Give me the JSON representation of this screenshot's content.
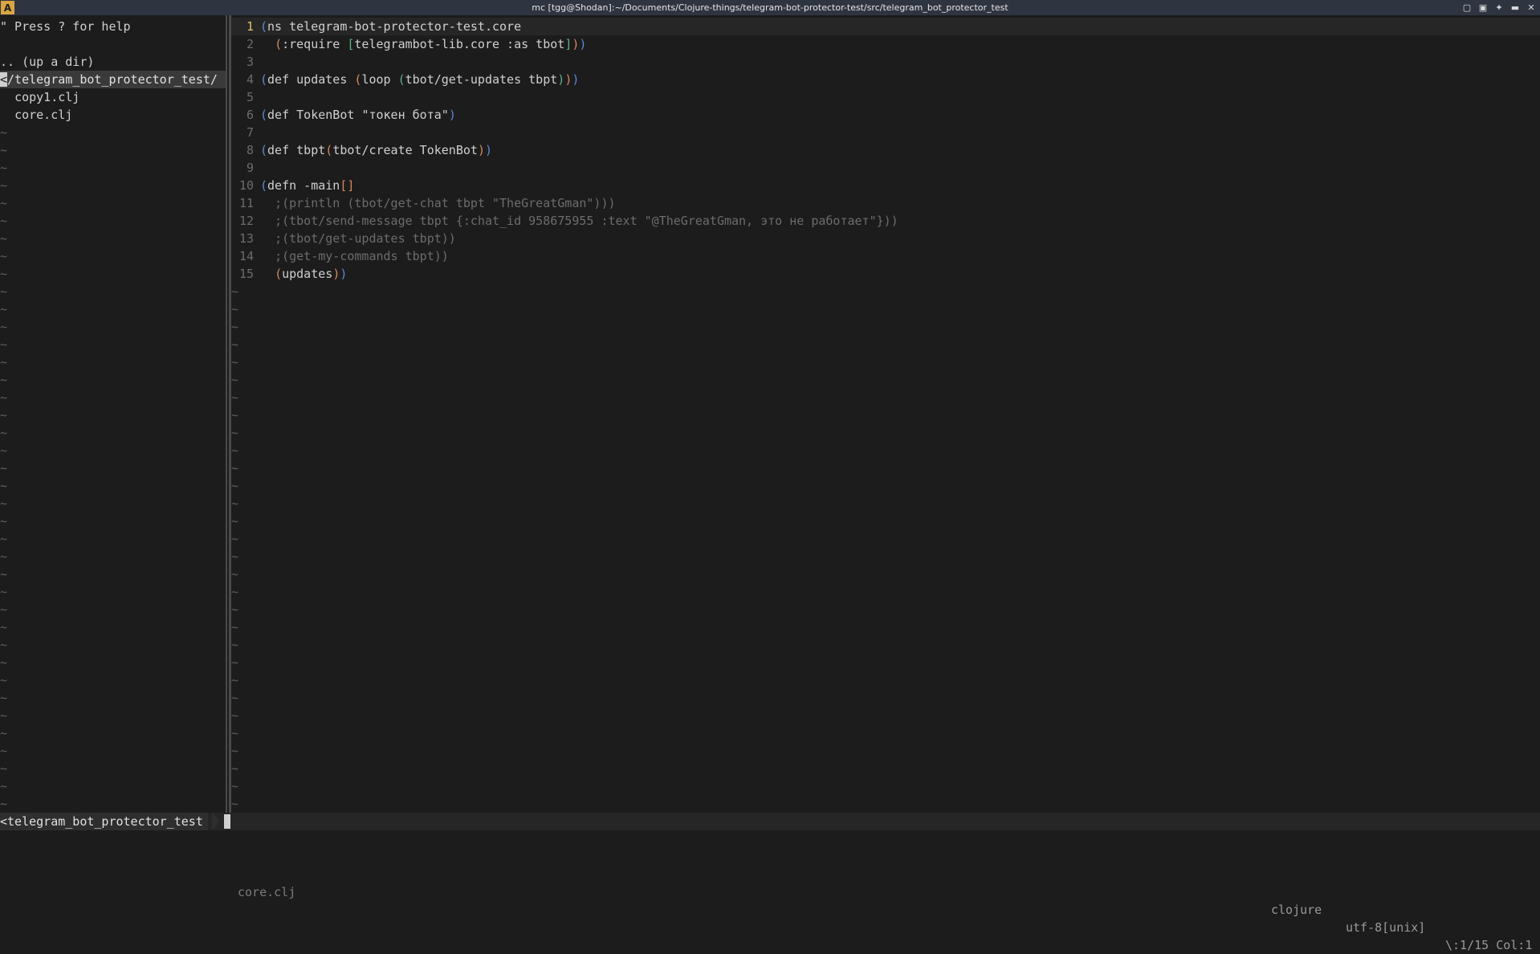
{
  "window": {
    "title": "mc [tgg@Shodan]:~/Documents/Clojure-things/telegram-bot-protector-test/src/telegram_bot_protector_test",
    "app_icon_letter": "A"
  },
  "tree": {
    "help": "\" Press ? for help",
    "up_dir": ".. (up a dir)",
    "current_dir": "/telegram_bot_protector_test/",
    "files": [
      "copy1.clj",
      "core.clj"
    ]
  },
  "editor": {
    "line_numbers": [
      "1",
      "2",
      "3",
      "4",
      "5",
      "6",
      "7",
      "8",
      "9",
      "10",
      "11",
      "12",
      "13",
      "14",
      "15"
    ],
    "code": {
      "l1_kw": "ns telegram-bot-protector-test.core",
      "l2_kw": ":require ",
      "l2_body": "telegrambot-lib.core :as tbot",
      "l4_a": "def updates ",
      "l4_b": "loop ",
      "l4_c": "tbot/get-updates tbpt",
      "l6_a": "def TokenBot ",
      "l6_str": "\"токен бота\"",
      "l8_a": "def tbpt",
      "l8_b": "tbot/create TokenBot",
      "l10_a": "defn -main",
      "l11": ";(println (tbot/get-chat tbpt \"TheGreatGman\")))",
      "l12": ";(tbot/send-message tbpt {:chat_id 958675955 :text \"@TheGreatGman, это не работает\"}))",
      "l13": ";(tbot/get-updates tbpt))",
      "l14": ";(get-my-commands tbpt))",
      "l15": "updates"
    }
  },
  "status": {
    "tree_path": "<telegram_bot_protector_test",
    "file": "core.clj",
    "filetype": "clojure",
    "encoding": "utf-8[unix]",
    "position": "\\:1/15 Col:1"
  }
}
